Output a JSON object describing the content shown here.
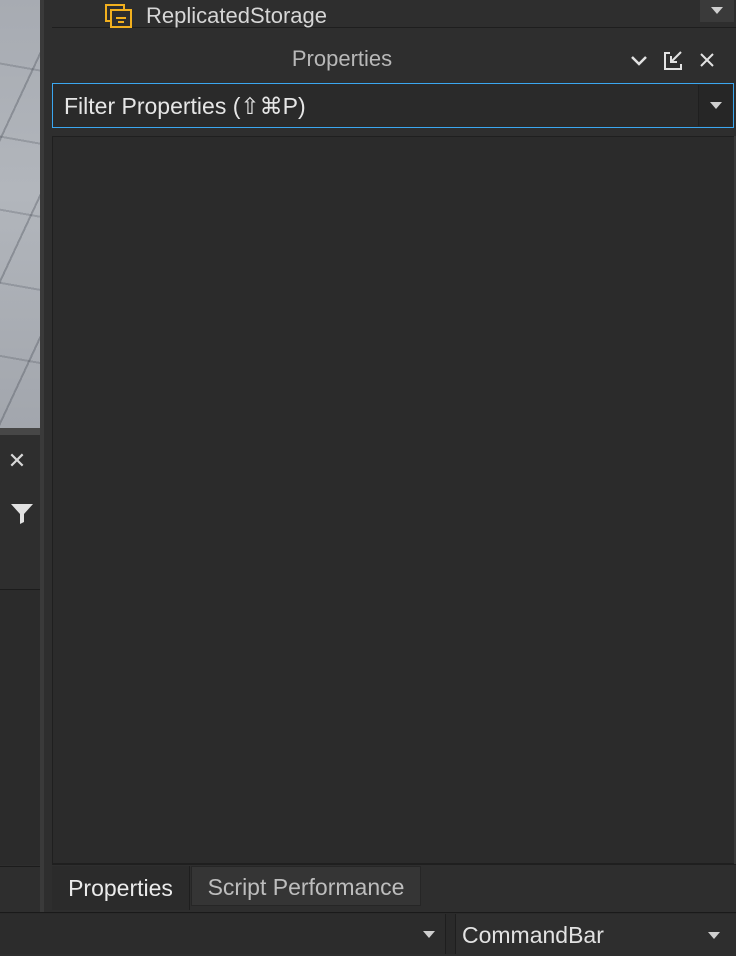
{
  "explorer": {
    "visible_item": {
      "label": "ReplicatedStorage",
      "icon": "replicated-storage-icon"
    }
  },
  "properties_panel": {
    "title": "Properties",
    "header_buttons": [
      {
        "name": "collapse",
        "icon": "chevron-down-icon",
        "glyph": "⌄"
      },
      {
        "name": "dock",
        "icon": "undock-icon",
        "glyph": "⇱"
      },
      {
        "name": "close",
        "icon": "close-icon",
        "glyph": "✕"
      }
    ],
    "filter": {
      "text": "Filter Properties (⇧⌘P)"
    }
  },
  "tabs": [
    {
      "label": "Properties",
      "active": true
    },
    {
      "label": "Script Performance",
      "active": false
    }
  ],
  "left_panel": {
    "close_glyph": "✕",
    "filter_icon": "filter-icon"
  },
  "bottom_bar": {
    "command_input": "",
    "command_selector": "CommandBar"
  },
  "colors": {
    "focus_border": "#3ba7f0",
    "panel_bg": "#2e2e2e",
    "body_bg": "#2b2b2b",
    "storage_icon": "#f2b01e"
  }
}
